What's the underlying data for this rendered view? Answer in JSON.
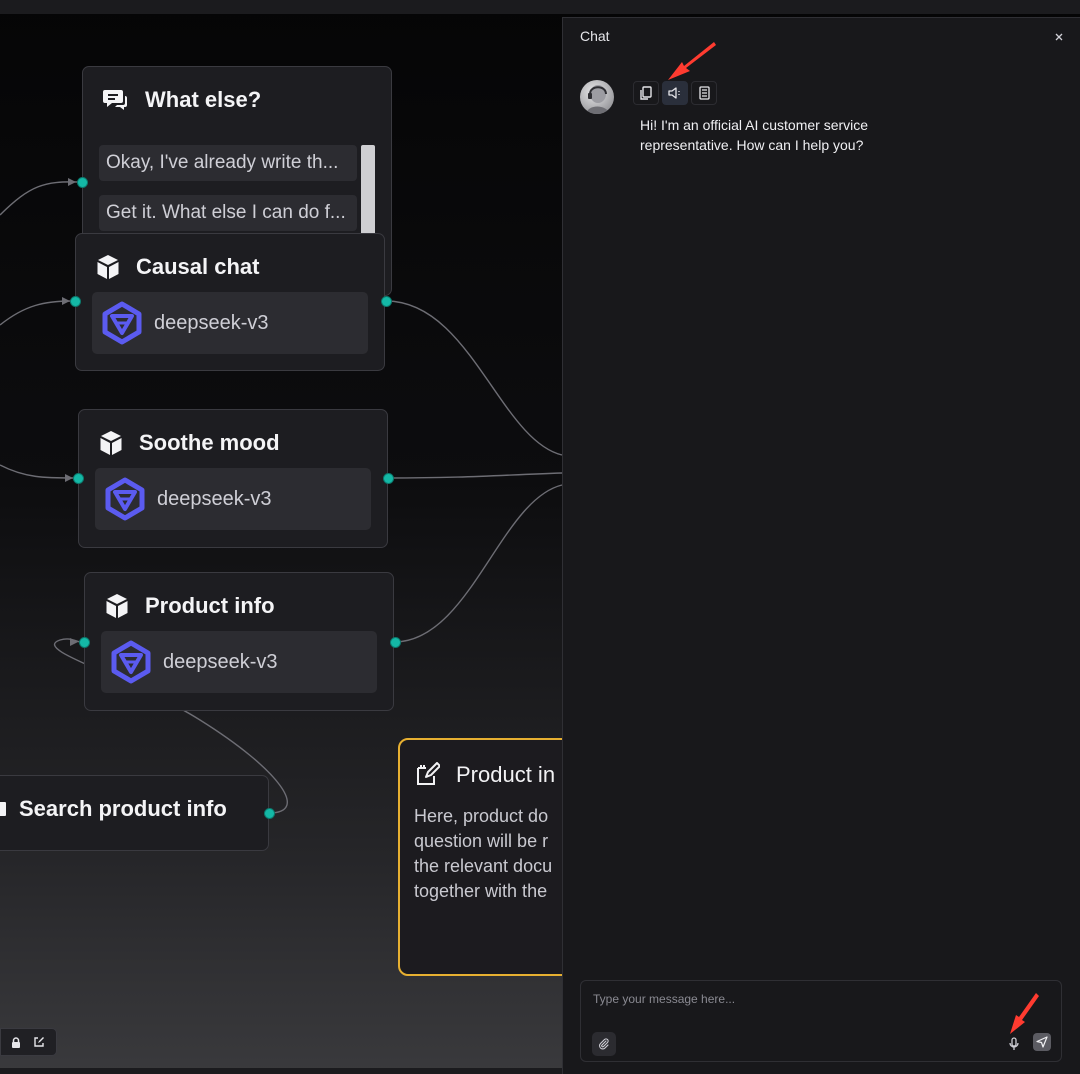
{
  "canvas": {
    "nodes": {
      "what_else": {
        "title": "What else?",
        "options": [
          "Okay, I've already write th...",
          "Get it. What else I can do f..."
        ]
      },
      "causal_chat": {
        "title": "Causal chat",
        "model": "deepseek-v3"
      },
      "soothe_mood": {
        "title": "Soothe mood",
        "model": "deepseek-v3"
      },
      "product_info": {
        "title": "Product info",
        "model": "deepseek-v3"
      },
      "search_product_info": {
        "title": "Search product info"
      },
      "note": {
        "title": "Product in",
        "lines": [
          "Here, product do",
          "question will be r",
          "the relevant docu",
          "together with the"
        ]
      }
    }
  },
  "chat": {
    "title": "Chat",
    "message": "Hi! I'm an official AI customer service representative. How can I help you?",
    "input_placeholder": "Type your message here..."
  },
  "colors": {
    "handle": "#14b8a6",
    "note_border": "#e7b031",
    "annotation_arrow": "#ff3b30",
    "llm_logo": "#5b5bf0"
  }
}
